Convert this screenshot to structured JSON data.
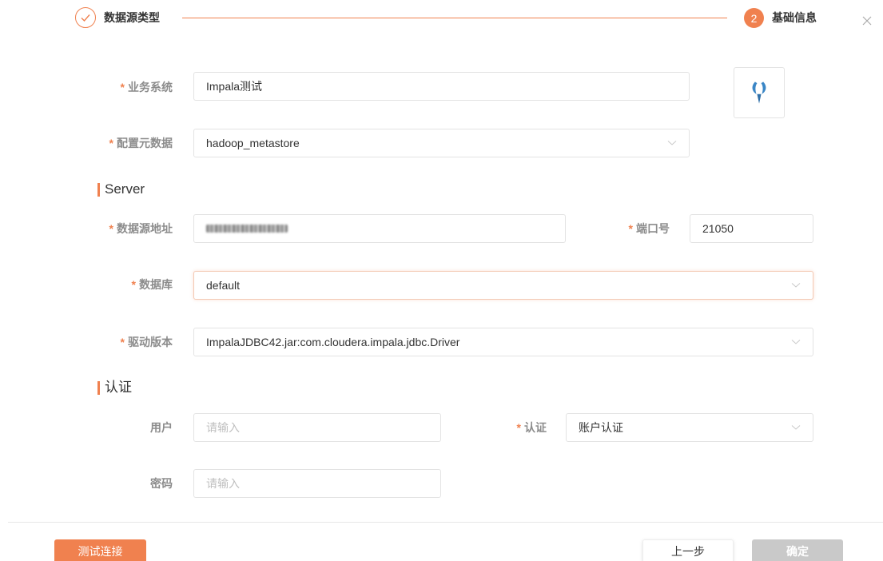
{
  "steps": {
    "step1_label": "数据源类型",
    "step2_number": "2",
    "step2_label": "基础信息"
  },
  "colors": {
    "accent": "#f0814f",
    "disabled": "#c9c9c9",
    "label": "#8c8c8c",
    "placeholder": "#bfbfbf"
  },
  "form": {
    "business_system": {
      "label": "业务系统",
      "value": "Impala测试"
    },
    "metadata": {
      "label": "配置元数据",
      "value": "hadoop_metastore"
    },
    "server_section": "Server",
    "address": {
      "label": "数据源地址",
      "value": ""
    },
    "port": {
      "label": "端口号",
      "value": "21050"
    },
    "database": {
      "label": "数据库",
      "value": "default"
    },
    "driver": {
      "label": "驱动版本",
      "value": "ImpalaJDBC42.jar:com.cloudera.impala.jdbc.Driver"
    },
    "auth_section": "认证",
    "user": {
      "label": "用户",
      "placeholder": "请输入"
    },
    "auth": {
      "label": "认证",
      "value": "账户认证"
    },
    "password": {
      "label": "密码",
      "placeholder": "请输入"
    }
  },
  "required_mark": "*",
  "icons": [
    "check-icon",
    "close-icon",
    "chevron-down-icon",
    "impala-logo"
  ],
  "footer": {
    "test_label": "测试连接",
    "prev_label": "上一步",
    "ok_label": "确定"
  }
}
